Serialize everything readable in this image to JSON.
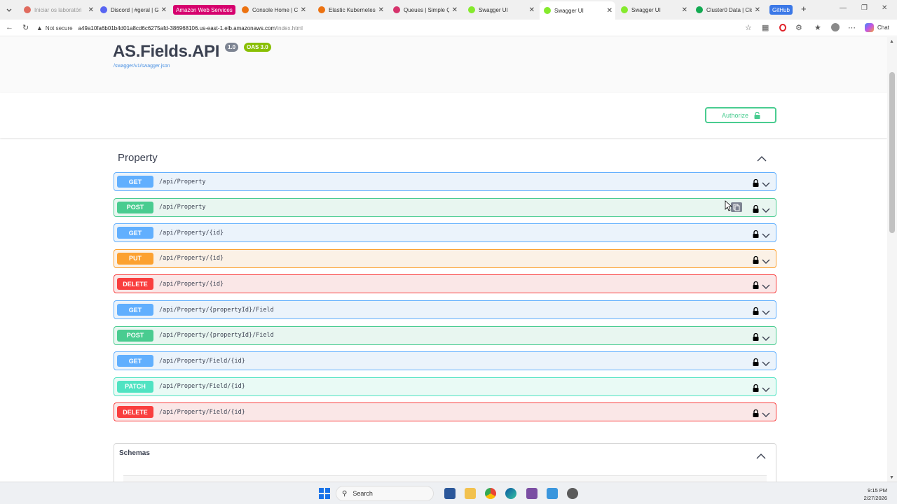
{
  "browser": {
    "tabs": [
      {
        "label": "Iniciar os laboratóri",
        "icon_color": "#e06b5e",
        "state": "faded"
      },
      {
        "label": "Discord | #geral | Gr",
        "icon_color": "#5865f2",
        "state": "normal"
      },
      {
        "label": "Console Home | Co",
        "icon_color": "#ec7211",
        "state": "normal"
      },
      {
        "label": "Elastic Kubernetes S",
        "icon_color": "#ec7211",
        "state": "normal"
      },
      {
        "label": "Queues | Simple Qu",
        "icon_color": "#d6336c",
        "state": "normal"
      },
      {
        "label": "Swagger UI",
        "icon_color": "#85ea2d",
        "state": "normal"
      },
      {
        "label": "Swagger UI",
        "icon_color": "#85ea2d",
        "state": "active"
      },
      {
        "label": "Swagger UI",
        "icon_color": "#85ea2d",
        "state": "normal"
      },
      {
        "label": "Cluster0 Data | Clou",
        "icon_color": "#13aa52",
        "state": "normal"
      }
    ],
    "group_badges": [
      {
        "label": "Amazon Web Services",
        "color": "#d6006e"
      },
      {
        "label": "GitHub",
        "color": "#3b78e7"
      }
    ],
    "new_tab": "+",
    "security_label": "Not secure",
    "url_host": "a49a10fa6b01b4d01a8cd6c6275afd-386968106.us-east-1.elb.amazonaws.com",
    "url_path": "/index.html",
    "chat_label": "Chat"
  },
  "swagger": {
    "title": "AS.Fields.API",
    "version": "1.0",
    "oas": "OAS 3.0",
    "spec_url": "/swagger/v1/swagger.json",
    "authorize_label": "Authorize",
    "tag": "Property",
    "operations": [
      {
        "method": "GET",
        "path": "/api/Property",
        "kind": "get"
      },
      {
        "method": "POST",
        "path": "/api/Property",
        "kind": "post"
      },
      {
        "method": "GET",
        "path": "/api/Property/{id}",
        "kind": "get"
      },
      {
        "method": "PUT",
        "path": "/api/Property/{id}",
        "kind": "put"
      },
      {
        "method": "DELETE",
        "path": "/api/Property/{id}",
        "kind": "delete"
      },
      {
        "method": "GET",
        "path": "/api/Property/{propertyId}/Field",
        "kind": "get"
      },
      {
        "method": "POST",
        "path": "/api/Property/{propertyId}/Field",
        "kind": "post"
      },
      {
        "method": "GET",
        "path": "/api/Property/Field/{id}",
        "kind": "get"
      },
      {
        "method": "PATCH",
        "path": "/api/Property/Field/{id}",
        "kind": "patch"
      },
      {
        "method": "DELETE",
        "path": "/api/Property/Field/{id}",
        "kind": "delete"
      }
    ],
    "schemas_label": "Schemas"
  },
  "taskbar": {
    "search_label": "Search",
    "time": "9:15 PM",
    "date": "2/27/2026"
  },
  "colors": {
    "get": "#61affe",
    "post": "#49cc90",
    "put": "#fca130",
    "delete": "#f93e3e",
    "patch": "#50e3c2"
  }
}
